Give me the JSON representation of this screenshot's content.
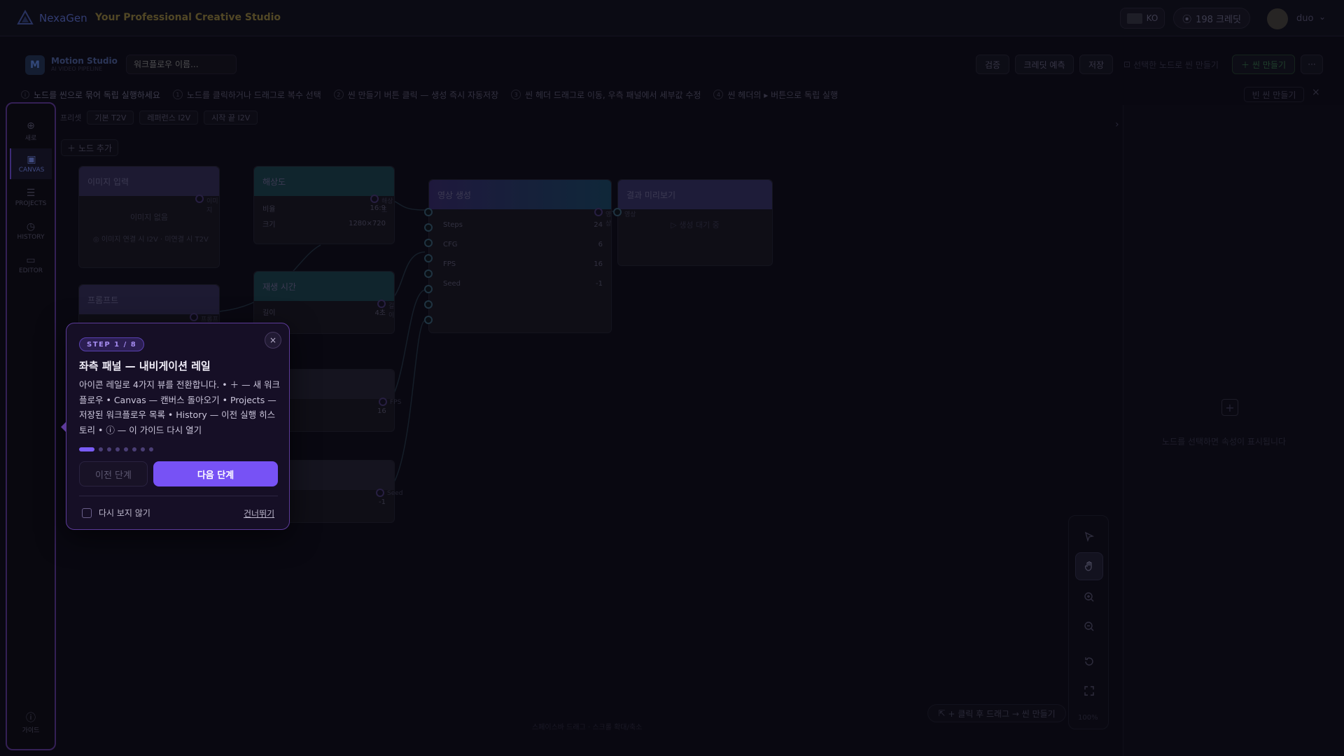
{
  "topbar": {
    "brand": "NexaGen",
    "tagline": "Your Professional Creative Studio",
    "lang": "KO",
    "credits": "198 크레딧",
    "username": "duo"
  },
  "studio": {
    "icon_letter": "M",
    "name": "Motion Studio",
    "sub": "AI VIDEO PIPELINE",
    "workflow_placeholder": "워크플로우 이름..."
  },
  "header_buttons": {
    "validate": "검증",
    "credit_estimate": "크레딧 예측",
    "save": "저장",
    "make_scene_selected": "선택한 노드로 씬 만들기",
    "make_scene": "씬 만들기",
    "more": "···"
  },
  "hints": {
    "lead": "노드를 씬으로 묶어 독립 실행하세요",
    "steps": [
      {
        "num": "1",
        "text": "노드를 클릭하거나 드래그로 복수 선택"
      },
      {
        "num": "2",
        "text": "씬 만들기 버튼 클릭 — 생성 즉시 자동저장"
      },
      {
        "num": "3",
        "text": "씬 헤더 드래그로 이동, 우측 패널에서 세부값 수정"
      },
      {
        "num": "4",
        "text": "씬 헤더의 ▸ 버튼으로 독립 실행"
      }
    ],
    "empty_scene": "빈 씬 만들기",
    "close": "×"
  },
  "presets": {
    "label": "프리셋",
    "items": [
      "기본 T2V",
      "레퍼런스 I2V",
      "시작 끝 I2V"
    ]
  },
  "add_node": "노드 추가",
  "rail": {
    "items": [
      {
        "label": "새로",
        "icon": "⊕"
      },
      {
        "label": "CANVAS",
        "icon": "▣"
      },
      {
        "label": "PROJECTS",
        "icon": "☰"
      },
      {
        "label": "HISTORY",
        "icon": "◷"
      },
      {
        "label": "EDITOR",
        "icon": "▭"
      }
    ],
    "guide": {
      "label": "가이드",
      "icon": "ⓘ"
    }
  },
  "nodes": {
    "image_input": {
      "title": "이미지 입력",
      "placeholder": "이미지 없음",
      "note": "◎ 이미지 연결 시 I2V · 미연결 시 T2V",
      "port": "이미지"
    },
    "resolution": {
      "title": "해상도",
      "rows": [
        {
          "k": "비율",
          "v": "16:9"
        },
        {
          "k": "크기",
          "v": "1280×720"
        }
      ],
      "port": "해상도"
    },
    "prompt": {
      "title": "프롬프트",
      "port": "프롬프트"
    },
    "duration": {
      "title": "재생 시간",
      "rows": [
        {
          "k": "길이",
          "v": "4초"
        }
      ],
      "port": "길이"
    },
    "fps_node": {
      "value": "16",
      "port": "FPS"
    },
    "seed_node": {
      "value": "-1",
      "port": "Seed"
    },
    "video_gen": {
      "title": "영상 생성",
      "rows": [
        {
          "k": "Steps",
          "v": "24"
        },
        {
          "k": "CFG",
          "v": "6"
        },
        {
          "k": "FPS",
          "v": "16"
        },
        {
          "k": "Seed",
          "v": "-1"
        }
      ],
      "port": "영상"
    },
    "preview": {
      "title": "결과 미리보기",
      "placeholder": "생성 대기 중",
      "port": "영상"
    }
  },
  "right_panel": {
    "empty_text": "노드를 선택하면 속성이 표시됩니다"
  },
  "toolbar": {
    "zoom": "100%"
  },
  "bottom_hint": "+ 클릭 후 드래그 → 씬 만들기",
  "center_hint": "스페이스바 드래그 · 스크롤 확대/축소",
  "tour": {
    "step": "STEP 1 / 8",
    "title": "좌측 패널 — 내비게이션 레일",
    "body": "아이콘 레일로 4가지 뷰를 전환합니다. • ＋ — 새 워크플로우 • Canvas — 캔버스 돌아오기 • Projects — 저장된 워크플로우 목록 • History — 이전 실행 히스토리 • ⓘ — 이 가이드 다시 열기",
    "prev": "이전 단계",
    "next": "다음 단계",
    "dont_show": "다시 보지 않기",
    "skip": "건너뛰기",
    "close": "×",
    "total_steps": 8,
    "current_step": 1
  },
  "colors": {
    "accent": "#7752f5",
    "rail_border": "#4d2e7d",
    "tour_border": "#5d3b9a"
  }
}
